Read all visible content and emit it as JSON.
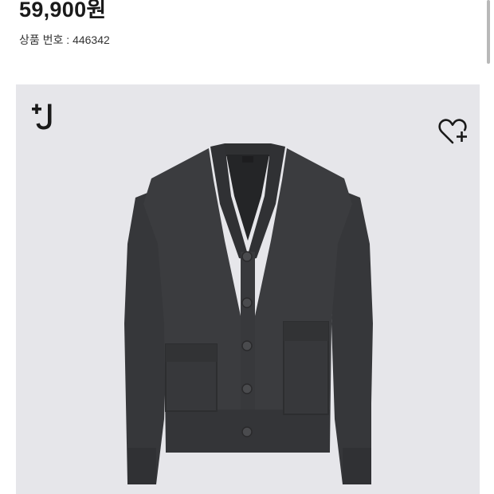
{
  "product": {
    "price": "59,900원",
    "code_label": "상품 번호 : 446342"
  },
  "image": {
    "brand_logo": "plus-j-logo",
    "wishlist_icon": "heart-plus-icon",
    "background_color": "#e6e6ea",
    "garment_color": "#3a3b3d"
  }
}
